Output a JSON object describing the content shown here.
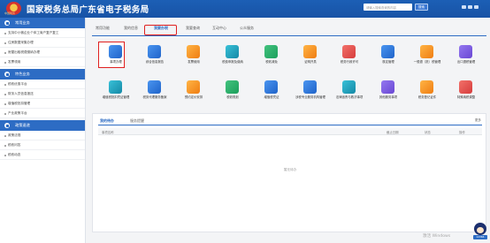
{
  "header": {
    "title": "国家税务总局广东省电子税务局",
    "emblem_text": "中国税务",
    "search_placeholder": "请输入搜索查询的内容",
    "search_button": "搜索"
  },
  "sidebar": {
    "sections": [
      {
        "title": "常用业务",
        "items": [
          "支持中小微企业个体工商户复产复工",
          "住房数据采集办理",
          "房屋出租税费缴纳办理",
          "发票领用"
        ]
      },
      {
        "title": "特色业务",
        "items": [
          "税收优惠平台",
          "财务人员信息报送",
          "增值税抵扣管理",
          "产业政策平台"
        ]
      },
      {
        "title": "政策速递",
        "items": [
          "政策法规",
          "税收问答",
          "税收动态"
        ]
      }
    ]
  },
  "tabs": [
    "常用功能",
    "我的信息",
    "我要办税",
    "我要查询",
    "互动中心",
    "公众服务"
  ],
  "active_tab": "我要办税",
  "tiles": [
    {
      "label": "事项办理",
      "icon": "pencil-icon",
      "color": "blue"
    },
    {
      "label": "综合信息报告",
      "icon": "document-icon",
      "color": "blue"
    },
    {
      "label": "发票使用",
      "icon": "invoice-icon",
      "color": "orange"
    },
    {
      "label": "税费申报及缴纳",
      "icon": "tax-icon",
      "color": "teal"
    },
    {
      "label": "税收减免",
      "icon": "discount-icon",
      "color": "green"
    },
    {
      "label": "证明开具",
      "icon": "certificate-icon",
      "color": "orange"
    },
    {
      "label": "税务行政许可",
      "icon": "license-icon",
      "color": "red"
    },
    {
      "label": "核定管理",
      "icon": "check-icon",
      "color": "blue"
    },
    {
      "label": "一般退（抵）税管理",
      "icon": "refund-icon",
      "color": "orange"
    },
    {
      "label": "出口退税管理",
      "icon": "export-icon",
      "color": "purple"
    },
    {
      "label": "增值税抵扣凭证管理",
      "icon": "voucher-icon",
      "color": "teal"
    },
    {
      "label": "税务代理服务备案",
      "icon": "agent-icon",
      "color": "blue"
    },
    {
      "label": "预约定价安排",
      "icon": "calendar-icon",
      "color": "orange"
    },
    {
      "label": "税收规划",
      "icon": "plan-icon",
      "color": "green"
    },
    {
      "label": "增值税凭证",
      "icon": "receipt-icon",
      "color": "blue"
    },
    {
      "label": "涉税专业服务机构管理",
      "icon": "institution-icon",
      "color": "blue"
    },
    {
      "label": "法律追责与救济事项",
      "icon": "gavel-icon",
      "color": "teal"
    },
    {
      "label": "其他服务事项",
      "icon": "service-icon",
      "color": "purple"
    },
    {
      "label": "税务登记证件",
      "icon": "id-card-icon",
      "color": "orange"
    },
    {
      "label": "特殊纳税调整",
      "icon": "adjust-icon",
      "color": "red"
    }
  ],
  "records": {
    "tabs": [
      "我的待办",
      "服务提醒"
    ],
    "active": "我的待办",
    "more": "更多",
    "columns": [
      "事项名称",
      "截止日期",
      "状态",
      "操作"
    ],
    "empty_text": "暂无待办"
  },
  "mascot_badge": "12366",
  "watermark": "激活 Windows",
  "colors": {
    "header": "#1c5fb5",
    "accent": "#2d6cc4",
    "highlight": "#e02020"
  }
}
